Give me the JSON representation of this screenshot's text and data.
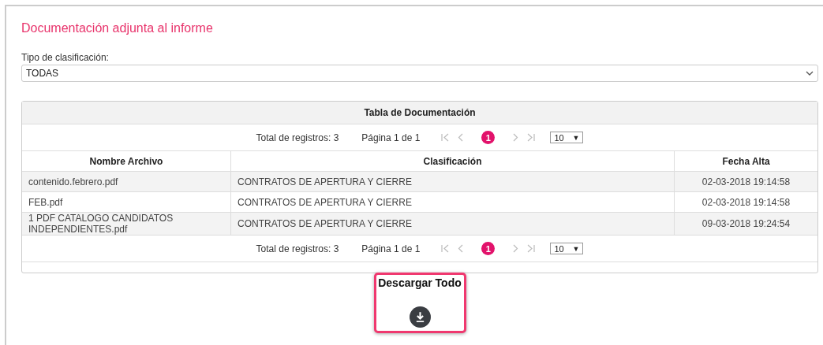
{
  "title": "Documentación adjunta al informe",
  "filter": {
    "label": "Tipo de clasificación:",
    "value": "TODAS"
  },
  "table": {
    "caption": "Tabla de Documentación",
    "pager_top": {
      "total": "Total de registros: 3",
      "page_info": "Página 1 de 1",
      "pages": [
        {
          "label": "1",
          "selected": true
        }
      ],
      "page_size": "10",
      "page_size_caret": "▼"
    },
    "columns": [
      "Nombre Archivo",
      "Clasificación",
      "Fecha Alta"
    ],
    "rows": [
      {
        "cells": [
          "contenido.febrero.pdf",
          "CONTRATOS DE APERTURA Y CIERRE",
          "02-03-2018 19:14:58"
        ]
      },
      {
        "cells": [
          "FEB.pdf",
          "CONTRATOS DE APERTURA Y CIERRE",
          "02-03-2018 19:14:58"
        ]
      },
      {
        "cells": [
          "1 PDF CATALOGO CANDIDATOS INDEPENDIENTES.pdf",
          "CONTRATOS DE APERTURA Y CIERRE",
          "09-03-2018 19:24:54"
        ]
      }
    ],
    "pager_bottom": {
      "total": "Total de registros: 3",
      "page_info": "Página 1 de 1",
      "pages": [
        {
          "label": "1",
          "selected": true
        }
      ],
      "page_size": "10",
      "page_size_caret": "▼"
    }
  },
  "download": {
    "label": "Descargar Todo"
  }
}
